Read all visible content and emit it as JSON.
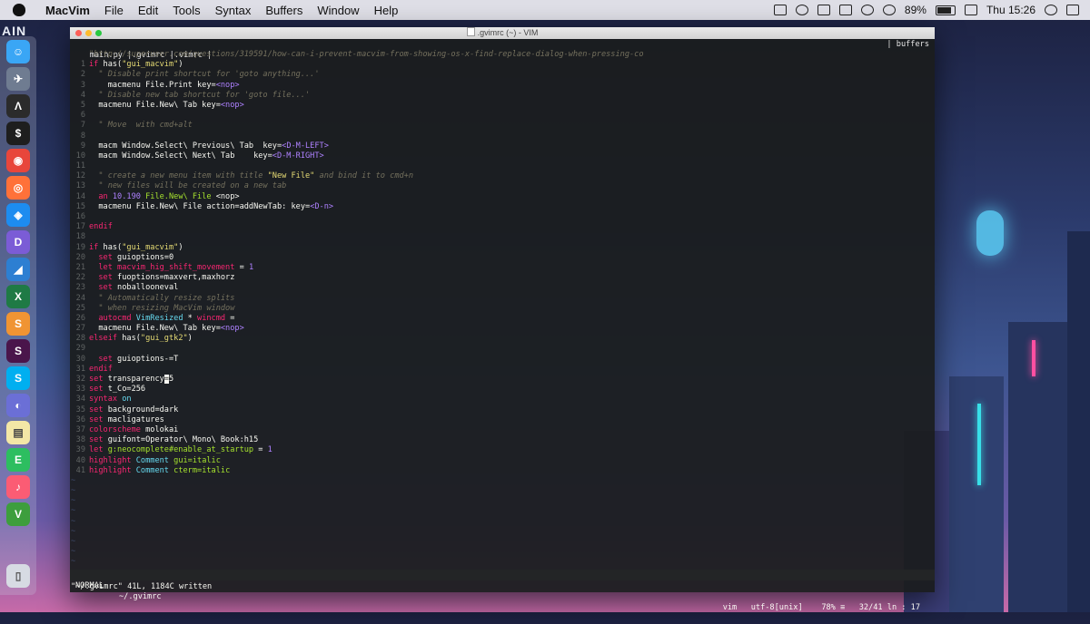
{
  "menubar": {
    "app": "MacVim",
    "items": [
      "File",
      "Edit",
      "Tools",
      "Syntax",
      "Buffers",
      "Window",
      "Help"
    ],
    "battery": "89%",
    "clock": "Thu 15:26"
  },
  "desktop": {
    "left_text": "AIN"
  },
  "dock": {
    "apps": [
      {
        "name": "finder",
        "color": "#3aa6f5",
        "glyph": "☺"
      },
      {
        "name": "launchpad",
        "color": "#6f7c91",
        "glyph": "✈"
      },
      {
        "name": "sublime",
        "color": "#2b2b2b",
        "glyph": "Λ"
      },
      {
        "name": "terminal",
        "color": "#1e1e1e",
        "glyph": "$"
      },
      {
        "name": "chrome",
        "color": "#e8463b",
        "glyph": "◉"
      },
      {
        "name": "firefox",
        "color": "#ff7139",
        "glyph": "◎"
      },
      {
        "name": "safari",
        "color": "#1d8cf0",
        "glyph": "◈"
      },
      {
        "name": "dash",
        "color": "#7b5cd6",
        "glyph": "D"
      },
      {
        "name": "xcode-tools",
        "color": "#2d7fd2",
        "glyph": "◢"
      },
      {
        "name": "excel",
        "color": "#1f7a45",
        "glyph": "X"
      },
      {
        "name": "sublime-merge",
        "color": "#f09433",
        "glyph": "S"
      },
      {
        "name": "slack",
        "color": "#4a154b",
        "glyph": "S"
      },
      {
        "name": "skype",
        "color": "#00aff0",
        "glyph": "S"
      },
      {
        "name": "tweetbot",
        "color": "#6b6fd6",
        "glyph": "◐"
      },
      {
        "name": "notes",
        "color": "#f3e7a6",
        "glyph": "▤"
      },
      {
        "name": "evernote",
        "color": "#2dbe60",
        "glyph": "E"
      },
      {
        "name": "itunes",
        "color": "#fb5c74",
        "glyph": "♪"
      },
      {
        "name": "vim",
        "color": "#3d9e3d",
        "glyph": "V"
      }
    ],
    "trash_glyph": "▯"
  },
  "window": {
    "title": ".gvimrc (~) - VIM",
    "tabline": "main.py |.gvimrc |.vimrc |",
    "tabline_right": "| buffers",
    "lines": [
      {
        "num": "",
        "spans": [
          [
            "c",
            "\"http://superuser.com/questions/319591/how-can-i-prevent-macvim-from-showing-os-x-find-replace-dialog-when-pressing-co"
          ]
        ]
      },
      {
        "num": "1",
        "spans": [
          [
            "k",
            "if "
          ],
          [
            "t",
            "has("
          ],
          [
            "s",
            "\"gui_macvim\""
          ],
          [
            "t",
            ")"
          ]
        ]
      },
      {
        "num": "2",
        "spans": [
          [
            "c",
            "  \" Disable print shortcut for 'goto anything...'"
          ]
        ]
      },
      {
        "num": "3",
        "spans": [
          [
            "t",
            "    macmenu File.Print key="
          ],
          [
            "n",
            "<nop>"
          ]
        ]
      },
      {
        "num": "4",
        "spans": [
          [
            "c",
            "  \" Disable new tab shortcut for 'goto file...'"
          ]
        ]
      },
      {
        "num": "5",
        "spans": [
          [
            "t",
            "  macmenu File.New\\ Tab key="
          ],
          [
            "n",
            "<nop>"
          ]
        ]
      },
      {
        "num": "6",
        "spans": []
      },
      {
        "num": "7",
        "spans": [
          [
            "c",
            "  \" Move  with cmd+alt"
          ]
        ]
      },
      {
        "num": "8",
        "spans": []
      },
      {
        "num": "9",
        "spans": [
          [
            "t",
            "  macm Window.Select\\ Previous\\ Tab  key="
          ],
          [
            "n",
            "<D-M-LEFT>"
          ]
        ]
      },
      {
        "num": "10",
        "spans": [
          [
            "t",
            "  macm Window.Select\\ Next\\ Tab    key="
          ],
          [
            "n",
            "<D-M-RIGHT>"
          ]
        ]
      },
      {
        "num": "11",
        "spans": []
      },
      {
        "num": "12",
        "spans": [
          [
            "c",
            "  \" create a new menu item with title "
          ],
          [
            "s",
            "\"New File\""
          ],
          [
            "c",
            " and bind it to cmd+n"
          ]
        ]
      },
      {
        "num": "13",
        "spans": [
          [
            "c",
            "  \" new files will be created on a new tab"
          ]
        ]
      },
      {
        "num": "14",
        "spans": [
          [
            "k",
            "  an "
          ],
          [
            "n",
            "10.190"
          ],
          [
            "g",
            " File.New\\ File"
          ],
          [
            "t",
            " <nop>"
          ]
        ]
      },
      {
        "num": "15",
        "spans": [
          [
            "t",
            "  macmenu File.New\\ File action=addNewTab: key="
          ],
          [
            "n",
            "<D-n>"
          ]
        ]
      },
      {
        "num": "16",
        "spans": []
      },
      {
        "num": "17",
        "spans": [
          [
            "k",
            "endif"
          ]
        ]
      },
      {
        "num": "18",
        "spans": []
      },
      {
        "num": "19",
        "spans": [
          [
            "k",
            "if "
          ],
          [
            "t",
            "has("
          ],
          [
            "s",
            "\"gui_macvim\""
          ],
          [
            "t",
            ")"
          ]
        ]
      },
      {
        "num": "20",
        "spans": [
          [
            "k",
            "  set "
          ],
          [
            "t",
            "guioptions=0"
          ]
        ]
      },
      {
        "num": "21",
        "spans": [
          [
            "k",
            "  let "
          ],
          [
            "k",
            "macvim_hig_shift_movement"
          ],
          [
            "t",
            " = "
          ],
          [
            "n",
            "1"
          ]
        ]
      },
      {
        "num": "22",
        "spans": [
          [
            "k",
            "  set "
          ],
          [
            "t",
            "fuoptions=maxvert,maxhorz"
          ]
        ]
      },
      {
        "num": "23",
        "spans": [
          [
            "k",
            "  set "
          ],
          [
            "t",
            "noballooneval"
          ]
        ]
      },
      {
        "num": "24",
        "spans": [
          [
            "c",
            "  \" Automatically resize splits"
          ]
        ]
      },
      {
        "num": "25",
        "spans": [
          [
            "c",
            "  \" when resizing MacVim window"
          ]
        ]
      },
      {
        "num": "26",
        "spans": [
          [
            "k",
            "  autocmd "
          ],
          [
            "f",
            "VimResized"
          ],
          [
            "t",
            " * "
          ],
          [
            "k",
            "wincmd"
          ],
          [
            "t",
            " ="
          ]
        ]
      },
      {
        "num": "27",
        "spans": [
          [
            "t",
            "  macmenu File.New\\ Tab key="
          ],
          [
            "n",
            "<nop>"
          ]
        ]
      },
      {
        "num": "28",
        "spans": [
          [
            "k",
            "elseif "
          ],
          [
            "t",
            "has("
          ],
          [
            "s",
            "\"gui_gtk2\""
          ],
          [
            "t",
            ")"
          ]
        ]
      },
      {
        "num": "29",
        "spans": []
      },
      {
        "num": "30",
        "spans": [
          [
            "k",
            "  set "
          ],
          [
            "t",
            "guioptions-=T"
          ]
        ]
      },
      {
        "num": "31",
        "spans": [
          [
            "k",
            "endif"
          ]
        ]
      },
      {
        "num": "32",
        "spans": [
          [
            "k",
            "set "
          ],
          [
            "t",
            "transparency"
          ],
          [
            "cur",
            "="
          ],
          [
            "t",
            "5"
          ]
        ]
      },
      {
        "num": "33",
        "spans": [
          [
            "k",
            "set "
          ],
          [
            "t",
            "t_Co=256"
          ]
        ]
      },
      {
        "num": "34",
        "spans": [
          [
            "k",
            "syntax "
          ],
          [
            "f",
            "on"
          ]
        ]
      },
      {
        "num": "35",
        "spans": [
          [
            "k",
            "set "
          ],
          [
            "t",
            "background=dark"
          ]
        ]
      },
      {
        "num": "36",
        "spans": [
          [
            "k",
            "set "
          ],
          [
            "t",
            "macligatures"
          ]
        ]
      },
      {
        "num": "37",
        "spans": [
          [
            "k",
            "colorscheme "
          ],
          [
            "t",
            "molokai"
          ]
        ]
      },
      {
        "num": "38",
        "spans": [
          [
            "k",
            "set "
          ],
          [
            "t",
            "guifont=Operator\\ Mono\\ Book:h15"
          ]
        ]
      },
      {
        "num": "39",
        "spans": [
          [
            "k",
            "let "
          ],
          [
            "g",
            "g:neocomplete#enable_at_startup"
          ],
          [
            "t",
            " = "
          ],
          [
            "n",
            "1"
          ]
        ]
      },
      {
        "num": "40",
        "spans": [
          [
            "k",
            "highlight "
          ],
          [
            "f",
            "Comment "
          ],
          [
            "g",
            "gui=italic"
          ]
        ]
      },
      {
        "num": "41",
        "spans": [
          [
            "k",
            "highlight "
          ],
          [
            "f",
            "Comment "
          ],
          [
            "g",
            "cterm=italic"
          ]
        ]
      }
    ],
    "tilde_count": 10,
    "tilde": "~",
    "status": {
      "mode": "NORMAL",
      "file": "~/.gvimrc",
      "right": "vim   utf-8[unix]    78% ≡   32/41 ln : 17"
    },
    "cmdline": "\"~/.gvimrc\" 41L, 1184C written"
  },
  "colors": {
    "keyword": "#f92672",
    "string": "#e6db74",
    "comment": "#75715e",
    "number": "#ae81ff",
    "green": "#a6e22e",
    "cyan": "#66d9ef",
    "fg": "#f8f8f2",
    "bg": "#1b1d1e"
  }
}
